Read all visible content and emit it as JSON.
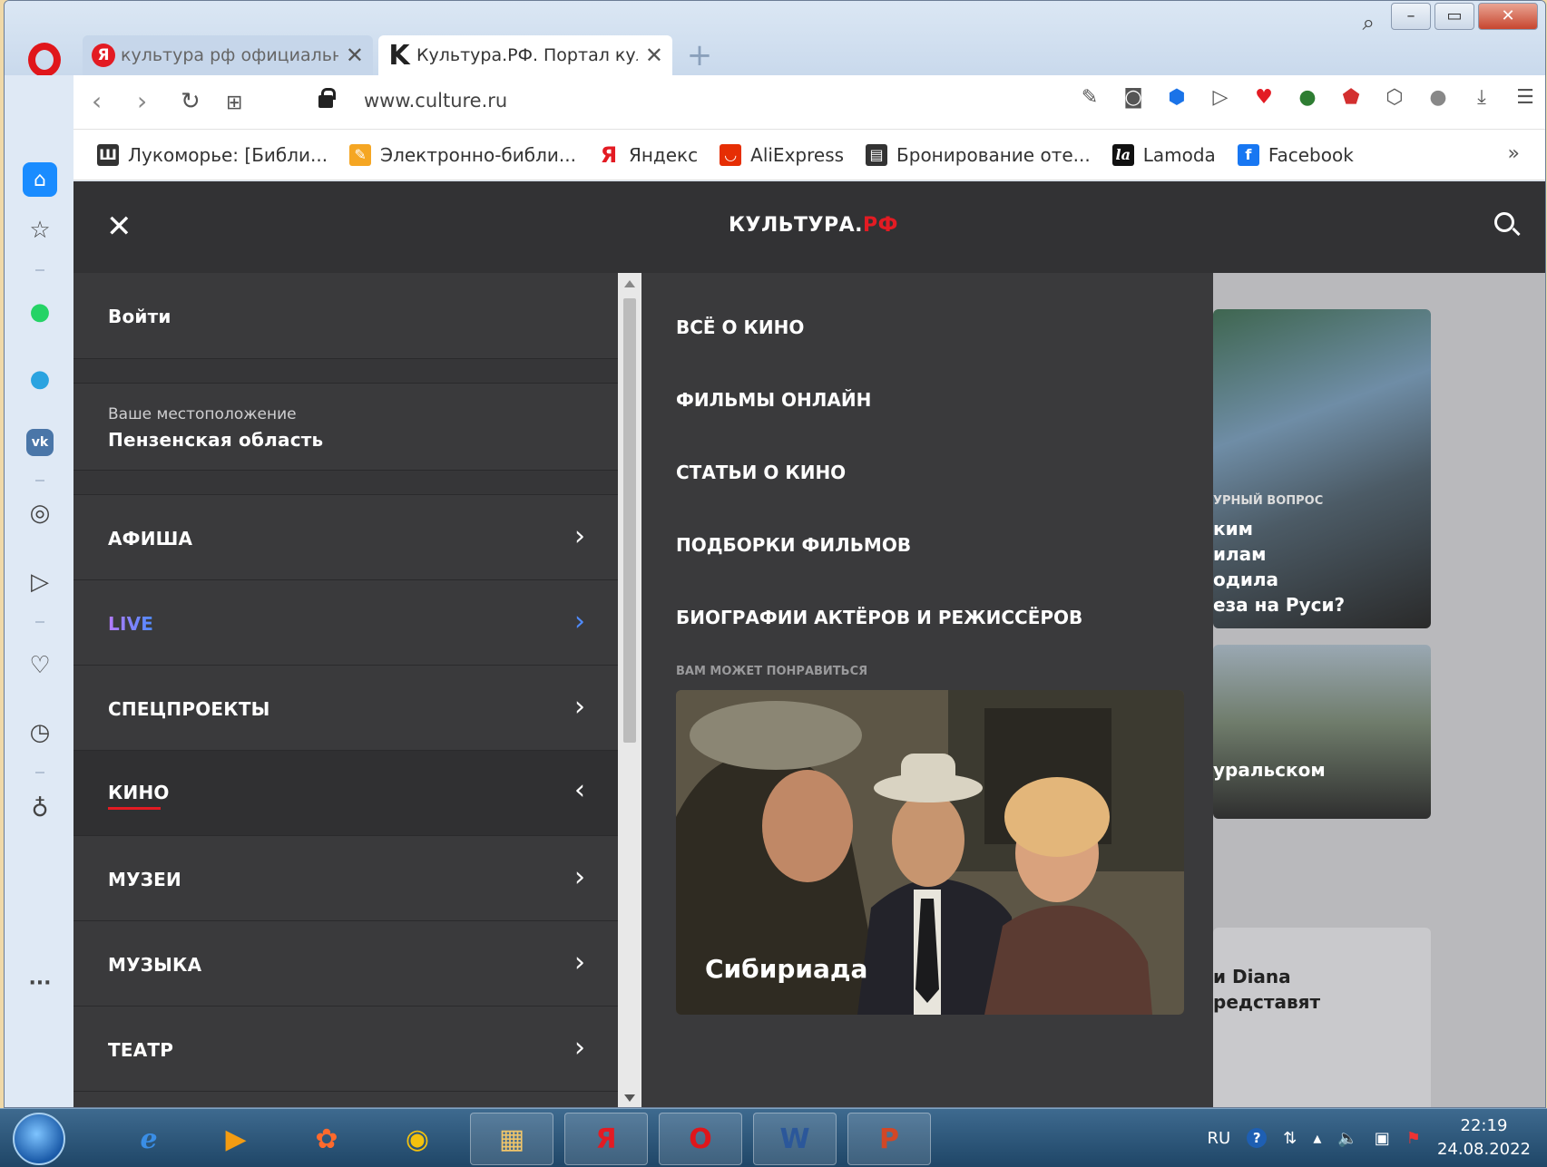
{
  "browser": {
    "tabs": [
      {
        "title": "культура рф официальны",
        "favicon": "Я",
        "active": false
      },
      {
        "title": "Культура.РФ. Портал культ",
        "favicon": "K",
        "active": true
      }
    ],
    "url": "www.culture.ru",
    "bookmarks": [
      {
        "label": "Лукоморье: [Библи...",
        "icon": "book-icon",
        "color": "#333333"
      },
      {
        "label": "Электронно-библи...",
        "icon": "library-icon",
        "color": "#f5a623"
      },
      {
        "label": "Яндекс",
        "icon": "yandex-icon",
        "color": "#e31b23"
      },
      {
        "label": "AliExpress",
        "icon": "aliexpress-icon",
        "color": "#e62e04"
      },
      {
        "label": "Бронирование оте...",
        "icon": "document-icon",
        "color": "#333333"
      },
      {
        "label": "Lamoda",
        "icon": "lamoda-icon",
        "color": "#111111"
      },
      {
        "label": "Facebook",
        "icon": "facebook-icon",
        "color": "#1877f2"
      }
    ]
  },
  "site": {
    "logo_main": "КУЛЬТУРА.",
    "logo_accent": "РФ",
    "accent_color": "#e31b23"
  },
  "menu": {
    "login": "Войти",
    "location_caption": "Ваше местоположение",
    "location_value": "Пензенская область",
    "items": [
      {
        "label": "АФИША",
        "expanded": false
      },
      {
        "label": "LIVE",
        "expanded": false
      },
      {
        "label": "СПЕЦПРОЕКТЫ",
        "expanded": false
      },
      {
        "label": "КИНО",
        "expanded": true
      },
      {
        "label": "МУЗЕИ",
        "expanded": false
      },
      {
        "label": "МУЗЫКА",
        "expanded": false
      },
      {
        "label": "ТЕАТР",
        "expanded": false
      }
    ]
  },
  "submenu": {
    "items": [
      "ВСЁ О КИНО",
      "ФИЛЬМЫ ОНЛАЙН",
      "СТАТЬИ О КИНО",
      "ПОДБОРКИ ФИЛЬМОВ",
      "БИОГРАФИИ АКТЁРОВ И РЕЖИССЁРОВ"
    ],
    "recommend_caption": "ВАМ МОЖЕТ ПОНРАВИТЬСЯ",
    "film_title": "Сибириада"
  },
  "background": {
    "card1_tag": "УРНЫЙ ВОПРОС",
    "card1_lines": [
      "ким",
      "илам",
      "одила",
      "еза на Руси?"
    ],
    "card2_text": "уральском",
    "card3_lines": [
      "и Diana",
      "редставят"
    ]
  },
  "taskbar": {
    "lang": "RU",
    "time": "22:19",
    "date": "24.08.2022"
  }
}
